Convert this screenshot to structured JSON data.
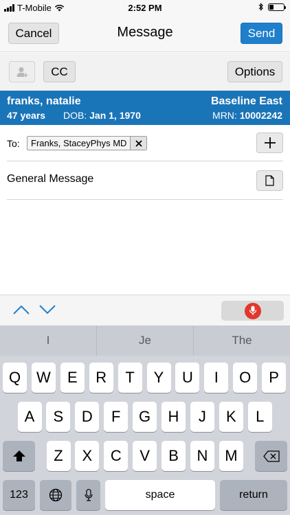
{
  "status_bar": {
    "carrier": "T-Mobile",
    "time": "2:52 PM",
    "battery_level": 0.3
  },
  "nav": {
    "cancel_label": "Cancel",
    "title": "Message",
    "send_label": "Send",
    "accent_color": "#1f7fcc"
  },
  "toolbar": {
    "add_person_icon": "add-person-icon",
    "cc_label": "CC",
    "options_label": "Options"
  },
  "patient": {
    "name": "franks, natalie",
    "location": "Baseline East",
    "age": "47 years",
    "dob_label": "DOB:",
    "dob_value": "Jan 1, 1970",
    "mrn_label": "MRN:",
    "mrn_value": "10002242",
    "banner_color": "#1a74b8"
  },
  "to": {
    "label": "To:",
    "recipients": [
      "Franks, StaceyPhys MD"
    ]
  },
  "subject": {
    "text": "General Message"
  },
  "keyboard": {
    "predictions": [
      "I",
      "Je",
      "The"
    ],
    "row1": [
      "Q",
      "W",
      "E",
      "R",
      "T",
      "Y",
      "U",
      "I",
      "O",
      "P"
    ],
    "row2": [
      "A",
      "S",
      "D",
      "F",
      "G",
      "H",
      "J",
      "K",
      "L"
    ],
    "row3": [
      "Z",
      "X",
      "C",
      "V",
      "B",
      "N",
      "M"
    ],
    "numbers_label": "123",
    "space_label": "space",
    "return_label": "return"
  }
}
